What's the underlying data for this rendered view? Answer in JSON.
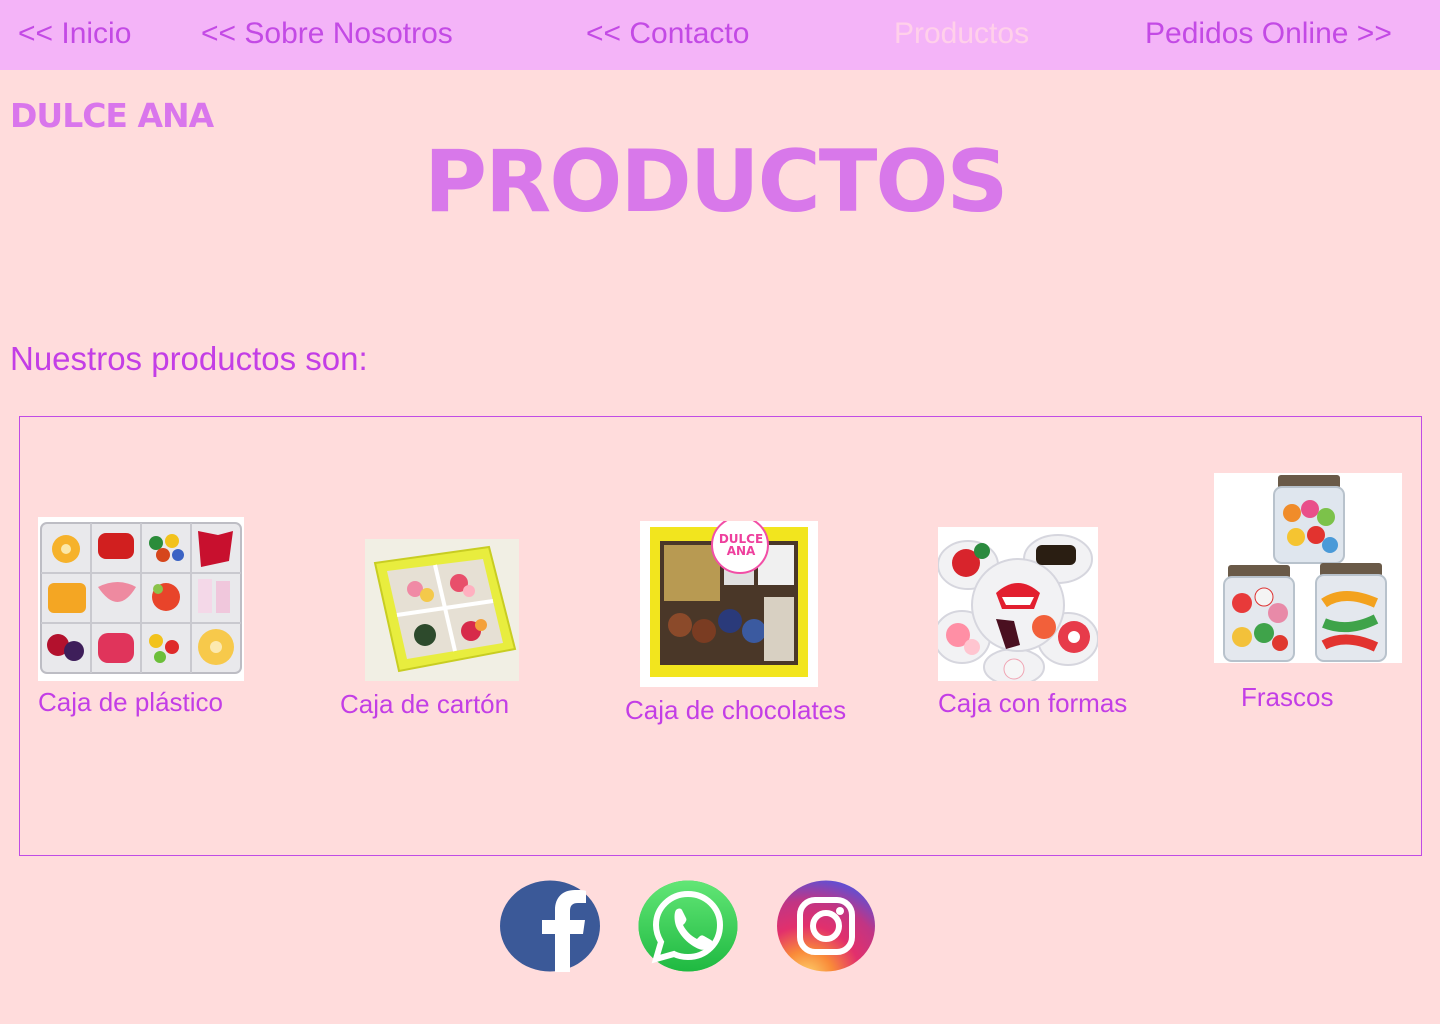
{
  "nav": {
    "inicio": "<<   Inicio",
    "sobre": "<<    Sobre Nosotros",
    "contacto": "<<   Contacto",
    "productos": "Productos",
    "pedidos": "Pedidos Online  >>"
  },
  "brand": "DULCE ANA",
  "page_title": "PRODUCTOS",
  "intro": "Nuestros productos son:",
  "products": [
    {
      "label": "Caja de plástico"
    },
    {
      "label": "Caja de cartón"
    },
    {
      "label": "Caja de chocolates",
      "badge": "DULCE ANA"
    },
    {
      "label": "Caja con formas"
    },
    {
      "label": "Frascos"
    }
  ],
  "social": [
    "facebook-icon",
    "whatsapp-icon",
    "instagram-icon"
  ],
  "colors": {
    "background": "#ffdcdc",
    "nav_background": "#f4b4f8",
    "accent": "#c33ee6",
    "title": "#d878ea",
    "facebook": "#3b5998",
    "whatsapp": "#25d366"
  }
}
